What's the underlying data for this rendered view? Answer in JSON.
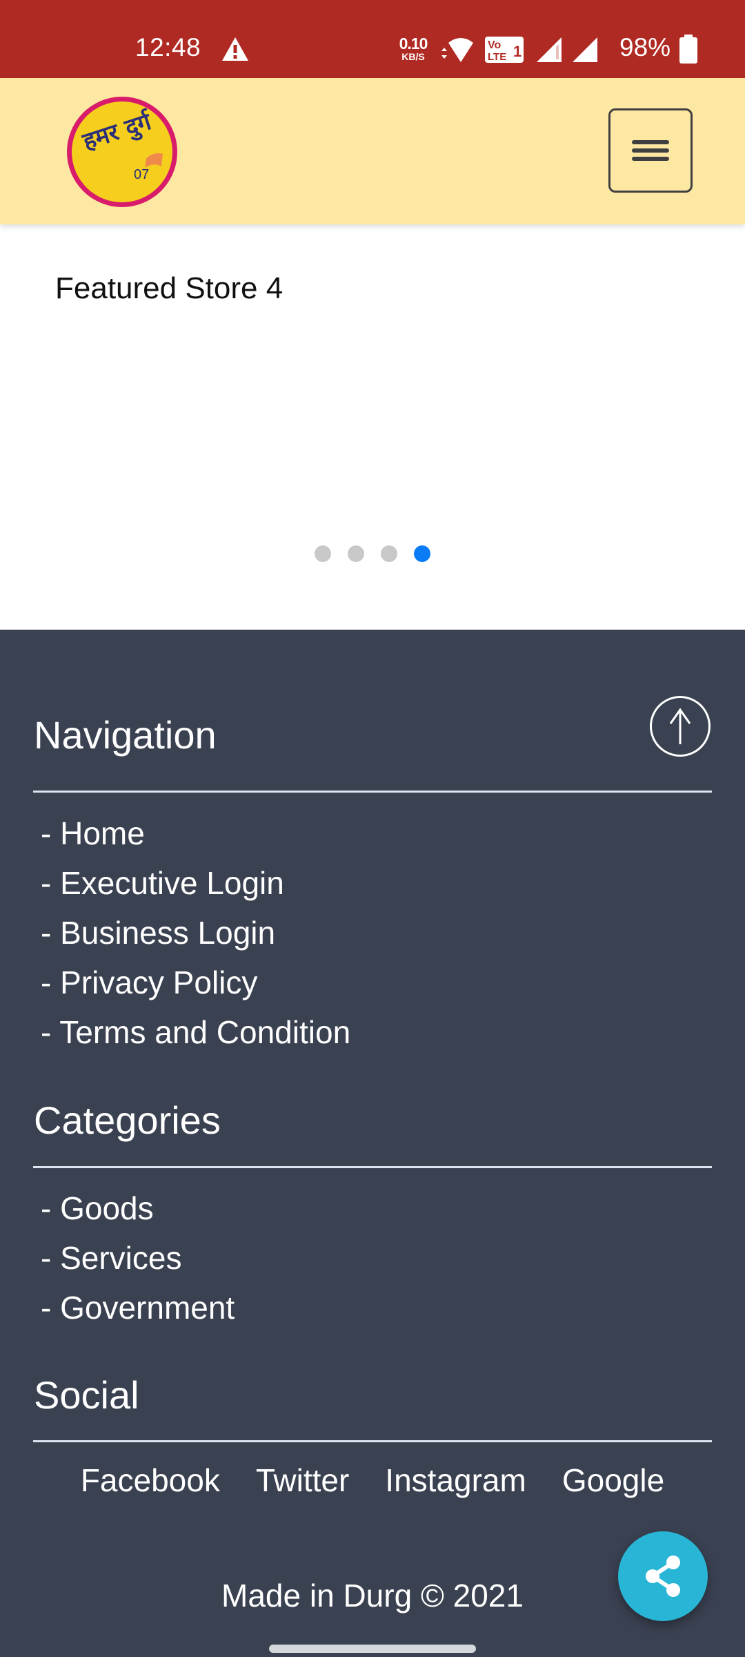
{
  "status_bar": {
    "time": "12:48",
    "net_speed_value": "0.10",
    "net_speed_unit": "KB/S",
    "volte_label": "Vo LTE 1",
    "battery_percent": "98%",
    "icons": [
      "warning-icon",
      "wifi-icon",
      "volte-icon",
      "signal-icon",
      "signal-icon",
      "battery-icon"
    ]
  },
  "header": {
    "logo_text": "हमर दुर्ग",
    "logo_number": "07",
    "menu_icon": "hamburger-icon"
  },
  "carousel": {
    "slide_title": "Featured Store 4",
    "slide_count": 4,
    "active_index": 3,
    "colors": {
      "active": "#0a7cf5",
      "inactive": "#c8c8c8"
    }
  },
  "footer": {
    "navigation": {
      "title": "Navigation",
      "items": [
        {
          "label": "- Home"
        },
        {
          "label": "- Executive Login"
        },
        {
          "label": "- Business Login"
        },
        {
          "label": "- Privacy Policy"
        },
        {
          "label": "- Terms and Condition"
        }
      ]
    },
    "categories": {
      "title": "Categories",
      "items": [
        {
          "label": "- Goods"
        },
        {
          "label": "- Services"
        },
        {
          "label": "- Government"
        }
      ]
    },
    "social": {
      "title": "Social",
      "items": [
        {
          "label": "Facebook"
        },
        {
          "label": "Twitter"
        },
        {
          "label": "Instagram"
        },
        {
          "label": "Google"
        }
      ]
    },
    "copyright": "Made in Durg © 2021",
    "scroll_top_icon": "arrow-up-circle-icon",
    "share_icon": "share-icon"
  },
  "colors": {
    "status_bar": "#b02a24",
    "header_bg": "#fde8a3",
    "footer_bg": "#3a4151",
    "fab_bg": "#29b6d6",
    "logo_yellow": "#f6cf1e",
    "logo_ring": "#d81b6a",
    "logo_ink": "#2b2f7a"
  }
}
